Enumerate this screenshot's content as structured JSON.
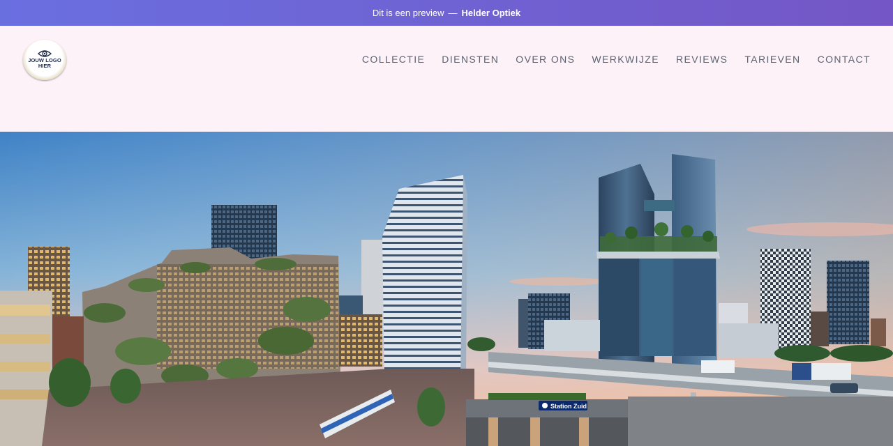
{
  "banner": {
    "prefix": "Dit is een preview",
    "separator": "—",
    "brand": "Helder Optiek"
  },
  "logo": {
    "text_line1": "JOUW LOGO",
    "text_line2": "HIER",
    "icon": "eye-icon"
  },
  "nav": {
    "items": [
      {
        "label": "COLLECTIE"
      },
      {
        "label": "DIENSTEN"
      },
      {
        "label": "OVER ONS"
      },
      {
        "label": "WERKWIJZE"
      },
      {
        "label": "REVIEWS"
      },
      {
        "label": "TARIEVEN"
      },
      {
        "label": "CONTACT"
      }
    ]
  },
  "hero": {
    "station_sign": "Station Zuid"
  },
  "colors": {
    "banner_start": "#6a6fe0",
    "banner_end": "#7456c6",
    "header_bg": "#fdf2f8",
    "nav_text": "#5b6272"
  }
}
